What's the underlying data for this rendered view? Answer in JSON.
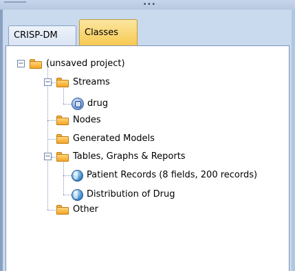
{
  "tabs": [
    {
      "label": "CRISP-DM"
    },
    {
      "label": "Classes"
    }
  ],
  "tree": {
    "root": {
      "label": "(unsaved project)",
      "expander": "−"
    },
    "streams": {
      "label": "Streams",
      "expander": "−",
      "children": [
        {
          "label": "drug"
        }
      ]
    },
    "nodes": {
      "label": "Nodes"
    },
    "generated_models": {
      "label": "Generated Models"
    },
    "tables": {
      "label": "Tables, Graphs & Reports",
      "expander": "−",
      "children": [
        {
          "label": "Patient Records (8 fields, 200 records)"
        },
        {
          "label": "Distribution of Drug"
        }
      ]
    },
    "other": {
      "label": "Other"
    }
  },
  "colors": {
    "active_tab": "#f7c84f",
    "folder": "#f5a623",
    "panel_bg": "#ffffff"
  }
}
